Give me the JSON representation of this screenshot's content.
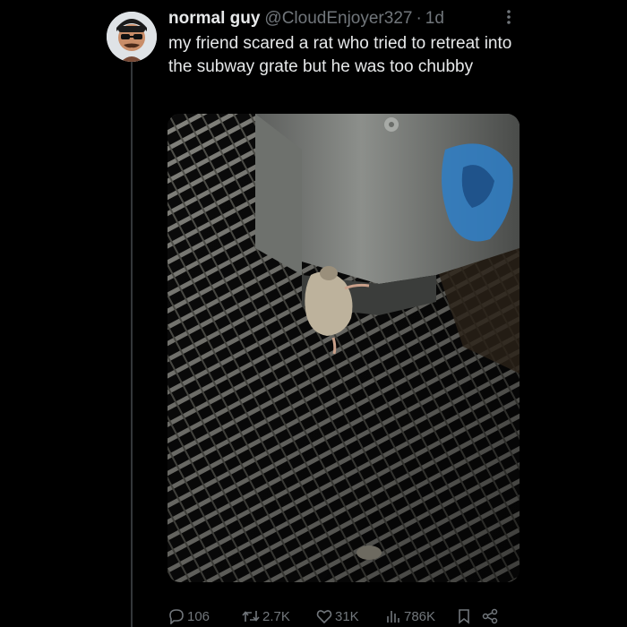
{
  "tweet": {
    "display_name": "normal guy",
    "handle": "@CloudEnjoyer327",
    "separator": "·",
    "time": "1d",
    "text": "my friend scared a rat who tried to retreat into the subway grate but he was too chubby",
    "more_icon": "more-vertical-icon"
  },
  "actions": {
    "replies": "106",
    "reposts": "2.7K",
    "likes": "31K",
    "views": "786K",
    "icons": [
      "reply-icon",
      "repost-icon",
      "like-icon",
      "views-icon",
      "bookmark-icon",
      "share-icon"
    ]
  },
  "colors": {
    "background": "#000000",
    "text_primary": "#e7e9ea",
    "text_secondary": "#71767b",
    "thread_line": "#333639"
  }
}
